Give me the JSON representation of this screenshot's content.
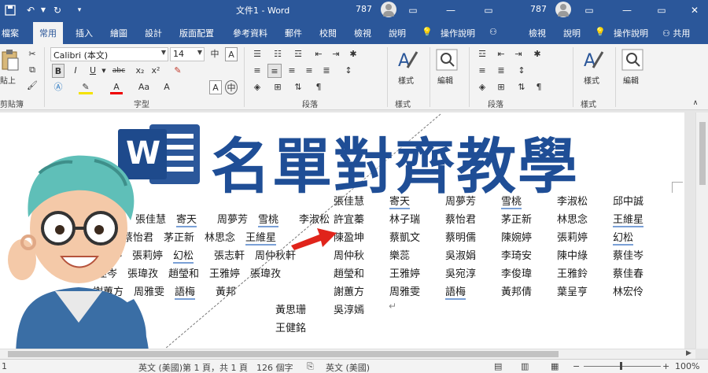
{
  "window": {
    "title": "文件1 - Word",
    "number": "787",
    "number_right": "787",
    "restore_glyph": "▭",
    "close_glyph": "✕",
    "min_glyph": "—"
  },
  "tabs": [
    "檔案",
    "常用",
    "插入",
    "繪圖",
    "設計",
    "版面配置",
    "參考資料",
    "郵件",
    "校閱",
    "檢視",
    "說明",
    "操作說明",
    "共用"
  ],
  "tabs_right": [
    "檢視",
    "說明",
    "操作說明",
    "共用"
  ],
  "ribbon": {
    "font_name": "Calibri (本文)",
    "font_size": "14",
    "paste_label": "貼上",
    "clipboard_label": "剪貼簿",
    "font_group_label": "字型",
    "paragraph_label": "段落",
    "styles_label": "樣式",
    "styles_group": "樣式",
    "edit_label": "編輯",
    "paragraph_label_right": "段落",
    "styles_group_right": "樣式",
    "styles_label_right": "樣式",
    "edit_label_right": "編輯",
    "wen_glyph": "中",
    "a_box": "A",
    "bold": "B",
    "italic": "I",
    "underline": "U",
    "strike": "abc",
    "aa": "Aa",
    "font_a": "A"
  },
  "overlay": {
    "headline": "名單對齊教學",
    "logo_letter": "W"
  },
  "names_left": [
    [
      "張佳慧",
      "寄天",
      "周夢芳",
      "雪桃",
      "李淑松"
    ],
    [
      "蔡怡君",
      "茅正新",
      "林思念",
      "王維星"
    ],
    [
      "張婉婷",
      "張莉婷",
      "幻松",
      "張志軒",
      "周仲秋軒"
    ],
    [
      "蔡佳岑",
      "張瑋孜",
      "趙瑩和",
      "王雅婷",
      "張瑋孜"
    ],
    [
      "謝蕙方",
      "周雅雯",
      "語梅",
      "黃邦"
    ],
    [
      "黃思珊"
    ],
    [
      "王健銘"
    ]
  ],
  "names_right": [
    [
      "張佳慧",
      "寄天",
      "周夢芳",
      "雪桃",
      "李淑松",
      "邱中誠"
    ],
    [
      "許宜蓁",
      "林子瑞",
      "蔡怡君",
      "茅正新",
      "林思念",
      "王維星"
    ],
    [
      "陳盈坤",
      "蔡凱文",
      "蔡明儒",
      "陳婉婷",
      "張莉婷",
      "幻松"
    ],
    [
      "周仲秋",
      "樂蕊",
      "吳淑娟",
      "李琦安",
      "陳中綠",
      "蔡佳岑"
    ],
    [
      "趙瑩和",
      "王雅婷",
      "吳宛淳",
      "李俊瑋",
      "王雅鈴",
      "蔡佳春"
    ],
    [
      "謝蕙方",
      "周雅雯",
      "語梅",
      "黃邦倩",
      "葉呈亨",
      "林宏伶"
    ],
    [
      "吳淳嫣"
    ]
  ],
  "status": {
    "lang": "英文 (美國)",
    "page": "第 1 頁，共 1 頁",
    "words": "126 個字",
    "lang_right": "英文 (美國)",
    "zoom": "100%",
    "minus": "−",
    "plus": "+",
    "left_num": "1"
  },
  "colors": {
    "word_blue": "#2b579a",
    "headline_blue": "#1f4e96",
    "arrow_red": "#e0241b",
    "underline_blue": "#7aa0d6"
  }
}
